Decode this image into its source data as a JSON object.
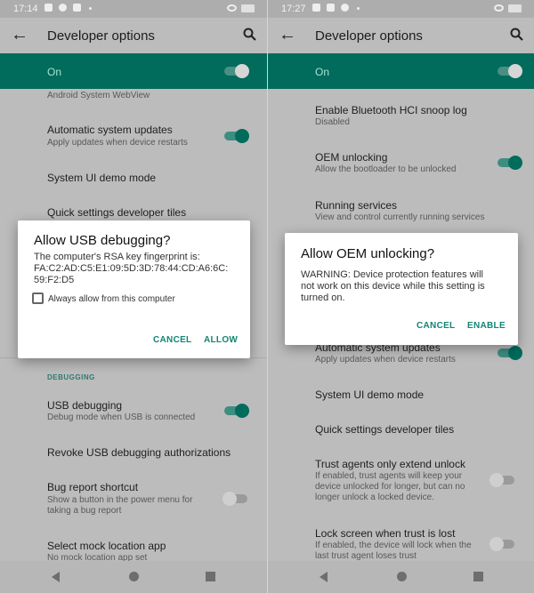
{
  "left": {
    "status": {
      "time": "17:14"
    },
    "title": "Developer options",
    "master": "On",
    "items": [
      {
        "sub": "Android System WebView"
      },
      {
        "title": "Automatic system updates",
        "sub": "Apply updates when device restarts",
        "toggle": true
      },
      {
        "title": "System UI demo mode"
      },
      {
        "title": "Quick settings developer tiles"
      }
    ],
    "category": "DEBUGGING",
    "items2": [
      {
        "title": "USB debugging",
        "sub": "Debug mode when USB is connected",
        "toggle": true
      },
      {
        "title": "Revoke USB debugging authorizations"
      },
      {
        "title": "Bug report shortcut",
        "sub1": "Show a button in the power menu for",
        "sub2": "taking a bug report",
        "toggle": false
      },
      {
        "title": "Select mock location app",
        "sub": "No mock location app set"
      }
    ],
    "dialog": {
      "title": "Allow USB debugging?",
      "line1": "The computer's RSA key fingerprint is:",
      "line2": "FA:C2:AD:C5:E1:09:5D:3D:78:44:CD:A6:6C:",
      "line3": "59:F2:D5",
      "checkbox": "Always allow from this computer",
      "checked": false,
      "cancel": "CANCEL",
      "ok": "ALLOW"
    }
  },
  "right": {
    "status": {
      "time": "17:27"
    },
    "title": "Developer options",
    "master": "On",
    "items": [
      {
        "title": "Enable Bluetooth HCI snoop log",
        "sub": "Disabled"
      },
      {
        "title": "OEM unlocking",
        "sub": "Allow the bootloader to be unlocked",
        "toggle": true
      },
      {
        "title": "Running services",
        "sub": "View and control currently running services"
      },
      {
        "title": "Automatic system updates",
        "sub": "Apply updates when device restarts",
        "toggle": true
      },
      {
        "title": "System UI demo mode"
      },
      {
        "title": "Quick settings developer tiles"
      },
      {
        "title": "Trust agents only extend unlock",
        "sub1": "If enabled, trust agents will keep your",
        "sub2": "device unlocked for longer, but can no",
        "sub3": "longer unlock a locked device.",
        "toggle": false
      },
      {
        "title": "Lock screen when trust is lost",
        "sub1": "If enabled, the device will lock when the",
        "sub2": "last trust agent loses trust",
        "toggle": false
      }
    ],
    "dialog": {
      "title": "Allow OEM unlocking?",
      "line1": "WARNING: Device protection features will",
      "line2": "not work on this device while this setting is",
      "line3": "turned on.",
      "cancel": "CANCEL",
      "ok": "ENABLE"
    }
  },
  "colors": {
    "accent": "#016b5c",
    "button": "#128575"
  }
}
